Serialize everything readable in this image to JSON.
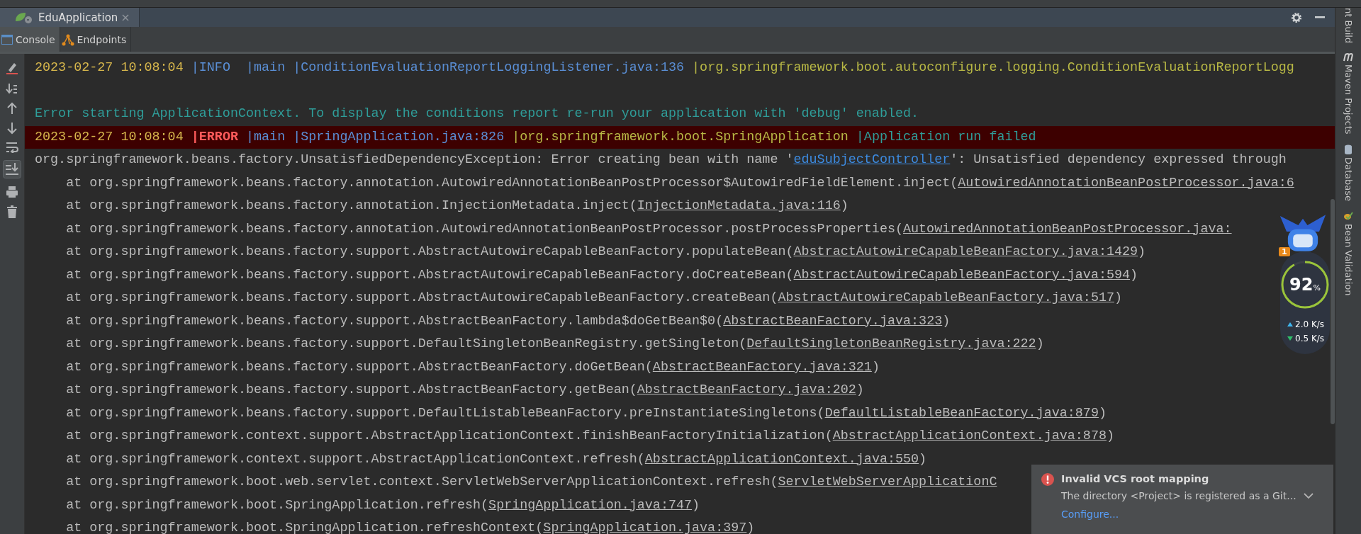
{
  "run_tab": {
    "title": "EduApplication",
    "selected": true
  },
  "tool_tabs": [
    {
      "label": "Console",
      "selected": true
    },
    {
      "label": "Endpoints",
      "selected": false
    }
  ],
  "log_lines": [
    {
      "kind": "info_log",
      "timestamp": "2023-02-27 10:08:04 ",
      "level": "|INFO  ",
      "thread": "|main ",
      "source": "|ConditionEvaluationReportLoggingListener.java:136 ",
      "logger": "|org.springframework.boot.autoconfigure.logging.ConditionEvaluationReportLogg"
    },
    {
      "kind": "blank"
    },
    {
      "kind": "notice",
      "text": "Error starting ApplicationContext. To display the conditions report re-run your application with 'debug' enabled."
    },
    {
      "kind": "error_log",
      "timestamp": "2023-02-27 10:08:04 ",
      "level": "|ERROR ",
      "thread": "|main ",
      "source": "|SpringApplication.java:826 ",
      "logger": "|org.springframework.boot.SpringApplication ",
      "message": "|Application run failed"
    },
    {
      "kind": "exception",
      "text": "org.springframework.beans.factory.UnsatisfiedDependencyException: Error creating bean with name '",
      "link": "eduSubjectController",
      "tail": "': Unsatisfied dependency expressed through"
    },
    {
      "kind": "frame",
      "text": "at org.springframework.beans.factory.annotation.AutowiredAnnotationBeanPostProcessor$AutowiredFieldElement.inject(",
      "link": "AutowiredAnnotationBeanPostProcessor.java:6"
    },
    {
      "kind": "frame",
      "text": "at org.springframework.beans.factory.annotation.InjectionMetadata.inject(",
      "link": "InjectionMetadata.java:116",
      "tail": ")"
    },
    {
      "kind": "frame",
      "text": "at org.springframework.beans.factory.annotation.AutowiredAnnotationBeanPostProcessor.postProcessProperties(",
      "link": "AutowiredAnnotationBeanPostProcessor.java:"
    },
    {
      "kind": "frame",
      "text": "at org.springframework.beans.factory.support.AbstractAutowireCapableBeanFactory.populateBean(",
      "link": "AbstractAutowireCapableBeanFactory.java:1429",
      "tail": ")"
    },
    {
      "kind": "frame",
      "text": "at org.springframework.beans.factory.support.AbstractAutowireCapableBeanFactory.doCreateBean(",
      "link": "AbstractAutowireCapableBeanFactory.java:594",
      "tail": ")"
    },
    {
      "kind": "frame",
      "text": "at org.springframework.beans.factory.support.AbstractAutowireCapableBeanFactory.createBean(",
      "link": "AbstractAutowireCapableBeanFactory.java:517",
      "tail": ")"
    },
    {
      "kind": "frame",
      "text": "at org.springframework.beans.factory.support.AbstractBeanFactory.lambda$doGetBean$0(",
      "link": "AbstractBeanFactory.java:323",
      "tail": ")"
    },
    {
      "kind": "frame",
      "text": "at org.springframework.beans.factory.support.DefaultSingletonBeanRegistry.getSingleton(",
      "link": "DefaultSingletonBeanRegistry.java:222",
      "tail": ")"
    },
    {
      "kind": "frame",
      "text": "at org.springframework.beans.factory.support.AbstractBeanFactory.doGetBean(",
      "link": "AbstractBeanFactory.java:321",
      "tail": ")"
    },
    {
      "kind": "frame",
      "text": "at org.springframework.beans.factory.support.AbstractBeanFactory.getBean(",
      "link": "AbstractBeanFactory.java:202",
      "tail": ")"
    },
    {
      "kind": "frame",
      "text": "at org.springframework.beans.factory.support.DefaultListableBeanFactory.preInstantiateSingletons(",
      "link": "DefaultListableBeanFactory.java:879",
      "tail": ")"
    },
    {
      "kind": "frame",
      "text": "at org.springframework.context.support.AbstractApplicationContext.finishBeanFactoryInitialization(",
      "link": "AbstractApplicationContext.java:878",
      "tail": ")"
    },
    {
      "kind": "frame",
      "text": "at org.springframework.context.support.AbstractApplicationContext.refresh(",
      "link": "AbstractApplicationContext.java:550",
      "tail": ")"
    },
    {
      "kind": "frame",
      "text": "at org.springframework.boot.web.servlet.context.ServletWebServerApplicationContext.refresh(",
      "link": "ServletWebServerApplicationC"
    },
    {
      "kind": "frame",
      "text": "at org.springframework.boot.SpringApplication.refresh(",
      "link": "SpringApplication.java:747",
      "tail": ")"
    },
    {
      "kind": "frame",
      "text": "at org.springframework.boot.SpringApplication.refreshContext(",
      "link": "SpringApplication.java:397",
      "tail": ")"
    }
  ],
  "side_panels": [
    "nt Build",
    "Maven Projects",
    "Database",
    "Bean Validation"
  ],
  "monitor_widget": {
    "badge": "1",
    "percent": "92",
    "percent_sign": "%",
    "upload": "2.0",
    "upload_unit": "K/s",
    "download": "0.5",
    "download_unit": "K/s"
  },
  "notification": {
    "title": "Invalid VCS root mapping",
    "body": "The directory <Project> is registered as a Git...",
    "action": "Configure..."
  }
}
